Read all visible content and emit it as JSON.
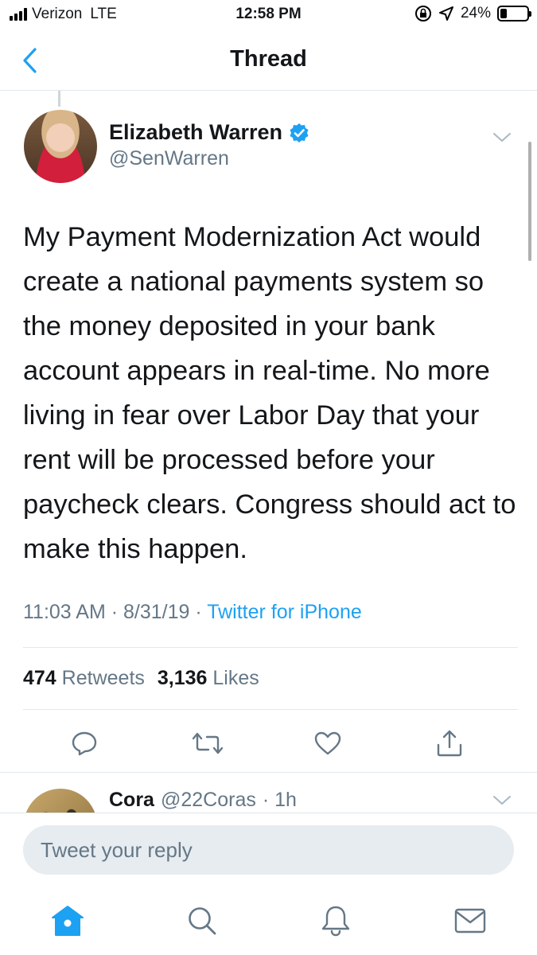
{
  "status_bar": {
    "carrier": "Verizon",
    "network": "LTE",
    "time": "12:58 PM",
    "battery": "24%",
    "battery_level": 0.24
  },
  "nav": {
    "title": "Thread",
    "back_icon": "chevron-left-icon"
  },
  "tweet": {
    "author_name": "Elizabeth Warren",
    "author_handle": "@SenWarren",
    "verified": true,
    "text": "My Payment Modernization Act would create a national payments system so the money deposited in your bank account appears in real-time. No more living in fear over Labor Day that your rent will be processed before your paycheck clears. Congress should act to make this happen.",
    "time": "11:03 AM",
    "date": "8/31/19",
    "separator": "·",
    "source": "Twitter for iPhone",
    "retweets_count": "474",
    "retweets_label": "Retweets",
    "likes_count": "3,136",
    "likes_label": "Likes"
  },
  "actions": [
    "reply-icon",
    "retweet-icon",
    "like-icon",
    "share-icon"
  ],
  "reply_preview": {
    "name": "Cora",
    "handle": "@22Coras",
    "age": "· 1h"
  },
  "compose": {
    "placeholder": "Tweet your reply"
  },
  "tab_bar": {
    "items": [
      "home-icon",
      "search-icon",
      "notifications-icon",
      "messages-icon"
    ],
    "active": "home-icon"
  },
  "colors": {
    "accent": "#1da1f2",
    "muted_text": "#657786",
    "divider": "#e1e8ed",
    "input_bg": "#e6ecf0"
  }
}
